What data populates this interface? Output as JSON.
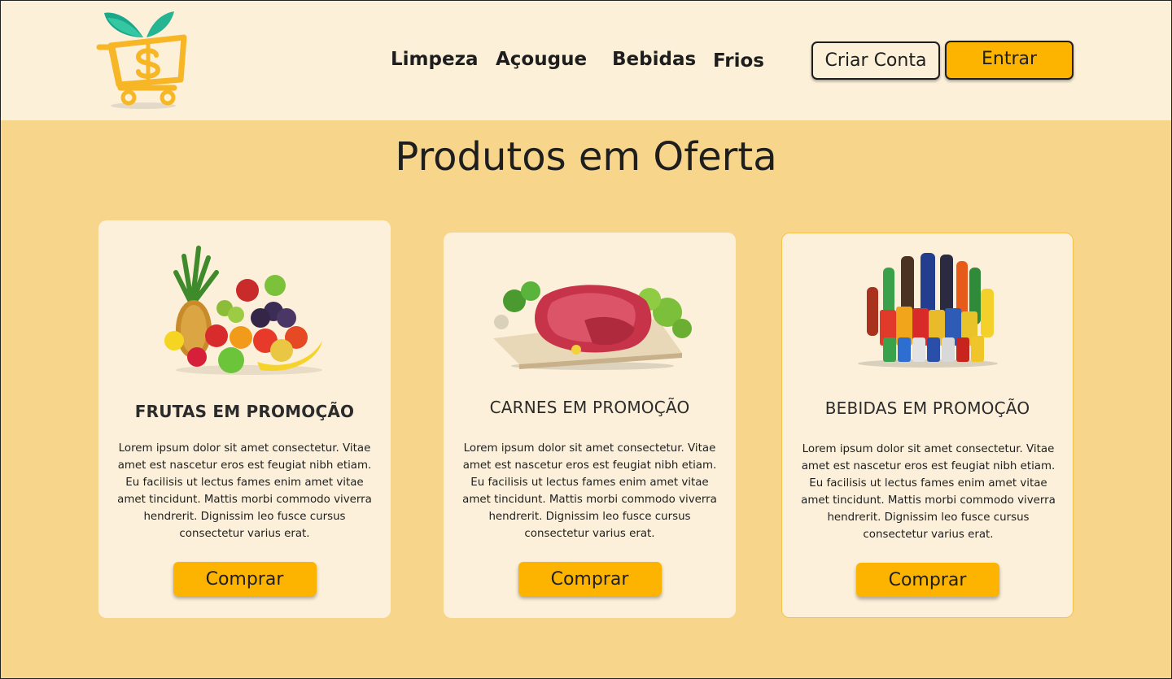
{
  "header": {
    "nav": [
      {
        "label": "Limpeza"
      },
      {
        "label": "Açougue"
      },
      {
        "label": "Bebidas"
      },
      {
        "label": "Frios"
      }
    ],
    "create_account_label": "Criar Conta",
    "login_label": "Entrar"
  },
  "main": {
    "title": "Produtos em Oferta",
    "cards": [
      {
        "title": "FRUTAS EM PROMOÇÃO",
        "description": "Lorem ipsum dolor sit amet consectetur. Vitae amet est nascetur eros est feugiat nibh etiam. Eu facilisis ut lectus fames enim amet vitae amet tincidunt. Mattis morbi commodo viverra hendrerit. Dignissim leo fusce cursus consectetur varius erat.",
        "button_label": "Comprar",
        "image": "fruits-image"
      },
      {
        "title": "CARNES EM PROMOÇÃO",
        "description": "Lorem ipsum dolor sit amet consectetur. Vitae amet est nascetur eros est feugiat nibh etiam. Eu facilisis ut lectus fames enim amet vitae amet tincidunt. Mattis morbi commodo viverra hendrerit. Dignissim leo fusce cursus consectetur varius erat.",
        "button_label": "Comprar",
        "image": "meat-image"
      },
      {
        "title": "BEBIDAS EM PROMOÇÃO",
        "description": "Lorem ipsum dolor sit amet consectetur. Vitae amet est nascetur eros est feugiat nibh etiam. Eu facilisis ut lectus fames enim amet vitae amet tincidunt. Mattis morbi commodo viverra hendrerit. Dignissim leo fusce cursus consectetur varius erat.",
        "button_label": "Comprar",
        "image": "drinks-image"
      }
    ]
  },
  "colors": {
    "header_bg": "#fcf0d9",
    "page_bg": "#f7d68c",
    "card_bg": "#fcf0da",
    "accent": "#fcb400",
    "text": "#1e1e1e"
  },
  "logo": {
    "icon": "shopping-cart-dollar-leaf-logo"
  }
}
